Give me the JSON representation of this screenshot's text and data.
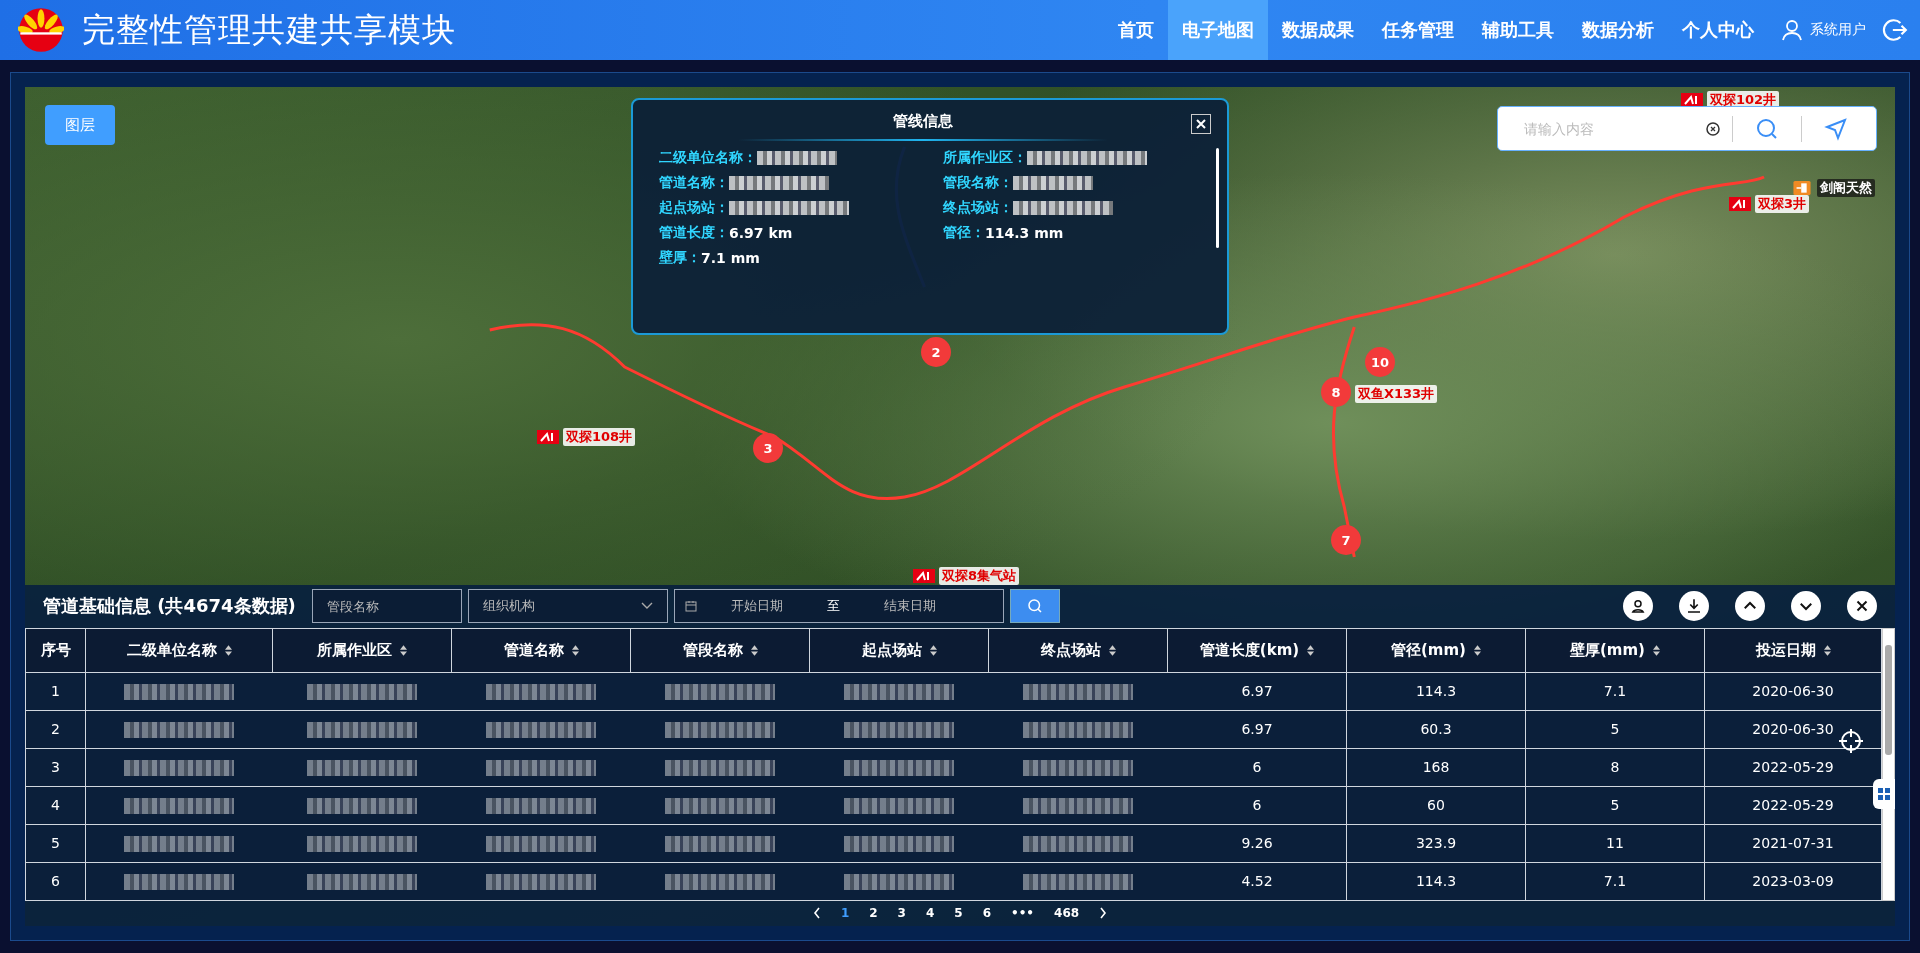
{
  "header": {
    "title": "完整性管理共建共享模块",
    "nav": [
      {
        "label": "首页",
        "selected": false
      },
      {
        "label": "电子地图",
        "selected": true
      },
      {
        "label": "数据成果",
        "selected": false
      },
      {
        "label": "任务管理",
        "selected": false
      },
      {
        "label": "辅助工具",
        "selected": false
      },
      {
        "label": "数据分析",
        "selected": false
      },
      {
        "label": "个人中心",
        "selected": false
      }
    ],
    "user": "系统用户"
  },
  "map": {
    "layer_button": "图层",
    "search": {
      "placeholder": "请输入内容"
    },
    "labels": [
      {
        "text": "双探102井",
        "kind": "well"
      },
      {
        "text": "剑阁天然",
        "kind": "station"
      },
      {
        "text": "双探3井",
        "kind": "well"
      },
      {
        "text": "双探108井",
        "kind": "well"
      },
      {
        "text": "双鱼X133井",
        "kind": "plain"
      },
      {
        "text": "双探8集气站",
        "kind": "well"
      }
    ],
    "pins": [
      "2",
      "3",
      "8",
      "10",
      "7"
    ]
  },
  "popup": {
    "title": "管线信息",
    "fields": [
      {
        "label": "二级单位名称：",
        "blurred": true
      },
      {
        "label": "所属作业区：",
        "blurred": true
      },
      {
        "label": "管道名称：",
        "blurred": true
      },
      {
        "label": "管段名称：",
        "blurred": true
      },
      {
        "label": "起点场站：",
        "blurred": true
      },
      {
        "label": "终点场站：",
        "blurred": true
      },
      {
        "label": "管道长度：",
        "value": "6.97 km",
        "blurred": false
      },
      {
        "label": "管径：",
        "value": "114.3 mm",
        "blurred": false
      },
      {
        "label": "壁厚：",
        "value": "7.1 mm",
        "blurred": false
      }
    ]
  },
  "panel": {
    "title": "管道基础信息 (共4674条数据)",
    "segment_field": {
      "placeholder": "管段名称"
    },
    "org_select": {
      "placeholder": "组织机构"
    },
    "start_date": {
      "placeholder": "开始日期"
    },
    "range_separator": "至",
    "end_date": {
      "placeholder": "结束日期"
    },
    "columns": [
      {
        "label": "序号",
        "sortable": false
      },
      {
        "label": "二级单位名称",
        "sortable": true
      },
      {
        "label": "所属作业区",
        "sortable": true
      },
      {
        "label": "管道名称",
        "sortable": true
      },
      {
        "label": "管段名称",
        "sortable": true
      },
      {
        "label": "起点场站",
        "sortable": true
      },
      {
        "label": "终点场站",
        "sortable": true
      },
      {
        "label": "管道长度(km)",
        "sortable": true
      },
      {
        "label": "管径(mm)",
        "sortable": true
      },
      {
        "label": "壁厚(mm)",
        "sortable": true
      },
      {
        "label": "投运日期",
        "sortable": true
      }
    ],
    "rows": [
      {
        "cells": [
          {
            "text": "1"
          },
          {
            "blurred": true
          },
          {
            "blurred": true
          },
          {
            "blurred": true
          },
          {
            "blurred": true
          },
          {
            "blurred": true
          },
          {
            "blurred": true
          },
          {
            "text": "6.97"
          },
          {
            "text": "114.3"
          },
          {
            "text": "7.1"
          },
          {
            "text": "2020-06-30"
          }
        ]
      },
      {
        "cells": [
          {
            "text": "2"
          },
          {
            "blurred": true
          },
          {
            "blurred": true
          },
          {
            "blurred": true
          },
          {
            "blurred": true
          },
          {
            "blurred": true
          },
          {
            "blurred": true
          },
          {
            "text": "6.97"
          },
          {
            "text": "60.3"
          },
          {
            "text": "5"
          },
          {
            "text": "2020-06-30"
          }
        ]
      },
      {
        "cells": [
          {
            "text": "3"
          },
          {
            "blurred": true
          },
          {
            "blurred": true
          },
          {
            "blurred": true
          },
          {
            "blurred": true
          },
          {
            "blurred": true
          },
          {
            "blurred": true
          },
          {
            "text": "6"
          },
          {
            "text": "168"
          },
          {
            "text": "8"
          },
          {
            "text": "2022-05-29"
          }
        ]
      },
      {
        "cells": [
          {
            "text": "4"
          },
          {
            "blurred": true
          },
          {
            "blurred": true
          },
          {
            "blurred": true
          },
          {
            "blurred": true
          },
          {
            "blurred": true
          },
          {
            "blurred": true
          },
          {
            "text": "6"
          },
          {
            "text": "60"
          },
          {
            "text": "5"
          },
          {
            "text": "2022-05-29"
          }
        ]
      },
      {
        "cells": [
          {
            "text": "5"
          },
          {
            "blurred": true
          },
          {
            "blurred": true
          },
          {
            "blurred": true
          },
          {
            "blurred": true
          },
          {
            "blurred": true
          },
          {
            "blurred": true
          },
          {
            "text": "9.26"
          },
          {
            "text": "323.9"
          },
          {
            "text": "11"
          },
          {
            "text": "2021-07-31"
          }
        ]
      },
      {
        "cells": [
          {
            "text": "6"
          },
          {
            "blurred": true
          },
          {
            "blurred": true
          },
          {
            "blurred": true
          },
          {
            "blurred": true
          },
          {
            "blurred": true
          },
          {
            "blurred": true
          },
          {
            "text": "4.52"
          },
          {
            "text": "114.3"
          },
          {
            "text": "7.1"
          },
          {
            "text": "2023-03-09"
          }
        ]
      }
    ],
    "pagination": {
      "pages": [
        {
          "label": "1",
          "selected": true
        },
        {
          "label": "2",
          "selected": false
        },
        {
          "label": "3",
          "selected": false
        },
        {
          "label": "4",
          "selected": false
        },
        {
          "label": "5",
          "selected": false
        },
        {
          "label": "6",
          "selected": false
        }
      ],
      "ellipsis": "•••",
      "last": "468"
    }
  }
}
